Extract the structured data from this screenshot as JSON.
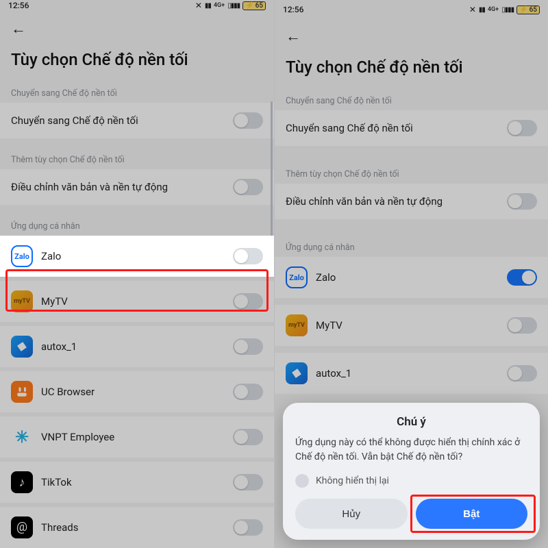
{
  "status": {
    "time": "12:56",
    "net": "4G+",
    "battery": "65"
  },
  "title": "Tùy chọn Chế độ nền tối",
  "section1": {
    "label": "Chuyển sang Chế độ nền tối",
    "row": "Chuyển sang Chế độ nền tối"
  },
  "section2": {
    "label": "Thêm tùy chọn Chế độ nền tối",
    "row": "Điều chỉnh văn bản và nền tự động"
  },
  "apps_label": "Ứng dụng cá nhân",
  "apps": [
    {
      "name": "Zalo"
    },
    {
      "name": "MyTV"
    },
    {
      "name": "autox_1"
    },
    {
      "name": "UC Browser"
    },
    {
      "name": "VNPT Employee"
    },
    {
      "name": "TikTok"
    },
    {
      "name": "Threads"
    }
  ],
  "dialog": {
    "title": "Chú ý",
    "body": "Ứng dụng này có thể không được hiển thị chính xác ở Chế độ nền tối. Vẫn bật Chế độ nền tối?",
    "checkbox": "Không hiển thị lại",
    "cancel": "Hủy",
    "ok": "Bật"
  }
}
